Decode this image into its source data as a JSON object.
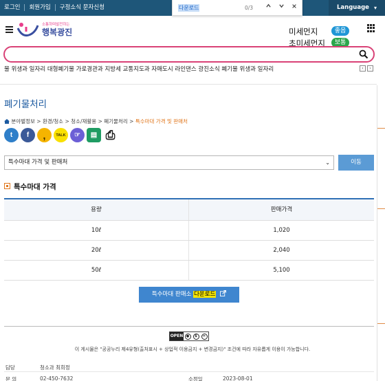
{
  "topbar": {
    "links": [
      "로그인",
      "회원가입",
      "구정소식 문자신청"
    ],
    "language_label": "Language"
  },
  "find_bar": {
    "query": "다운로드",
    "count": "0/3"
  },
  "header": {
    "logo_tagline": "소통하며발전하는",
    "logo_name": "행복광진",
    "air": [
      {
        "label": "미세먼지",
        "status": "좋음",
        "color": "#1f96d6"
      },
      {
        "label": "초미세먼지",
        "status": "보통",
        "color": "#2ba64b"
      }
    ]
  },
  "search": {
    "placeholder": ""
  },
  "keywords": "물  위생과  일자리  대형폐기물  가로경관과  지방세  교통지도과  자매도시  라인댄스  광진소식  폐기물  위생과  일자리",
  "page": {
    "title": "폐기물처리",
    "breadcrumb": [
      "분야별정보",
      "환경/청소",
      "청소/재활용",
      "폐기물처리"
    ],
    "breadcrumb_current": "특수마대 가격 및 판매처"
  },
  "share_icons": [
    {
      "name": "twitter-icon",
      "glyph": "t",
      "color": "#2f7fc9"
    },
    {
      "name": "facebook-icon",
      "glyph": "f",
      "color": "#3b5998"
    },
    {
      "name": "kakaostory-icon",
      "glyph": ",",
      "color": "#f5b400"
    },
    {
      "name": "kakaotalk-icon",
      "glyph": "TALK",
      "color": "#f9e000"
    },
    {
      "name": "band-icon",
      "glyph": "☞",
      "color": "#6c5fd6"
    },
    {
      "name": "print-preview-icon",
      "glyph": "▤",
      "color": "#1f9c63"
    },
    {
      "name": "print-icon",
      "glyph": "⎙",
      "color": "#222222"
    }
  ],
  "select": {
    "value": "특수마대 가격 및 판매처",
    "go_label": "이동"
  },
  "section_title": "특수마대 가격",
  "table": {
    "headers": [
      "용량",
      "판매가격"
    ],
    "rows": [
      [
        "10ℓ",
        "1,020"
      ],
      [
        "20ℓ",
        "2,040"
      ],
      [
        "50ℓ",
        "5,100"
      ]
    ]
  },
  "download": {
    "label": "특수마대 판매소",
    "highlight": "다운로드"
  },
  "license": {
    "open_label": "OPEN",
    "text": "이 게시물은 \"공공누리 제4유형(출처표시 + 상업적 이용금지 + 변경금지)\" 조건에 따라 자유롭게 이용이 가능합니다."
  },
  "info": {
    "dept_key": "담당",
    "dept_value": "청소과 최희정",
    "phone_key": "문 의",
    "phone_value": "02-450-7632",
    "modified_key": "수정일",
    "modified_value": "2023-08-01"
  }
}
